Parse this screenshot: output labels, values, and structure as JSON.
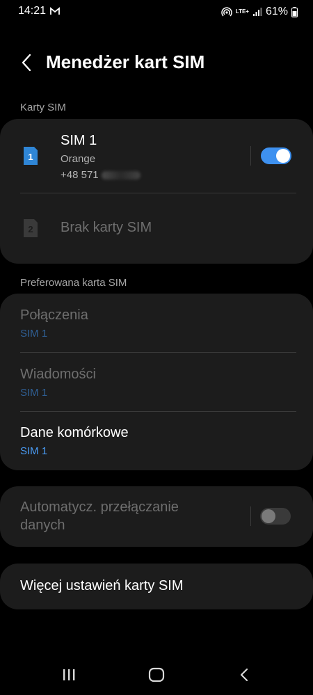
{
  "status_bar": {
    "time": "14:21",
    "battery_percent": "61%",
    "network_label": "LTE+"
  },
  "header": {
    "title": "Menedżer kart SIM"
  },
  "sim_section": {
    "label": "Karty SIM",
    "sim1": {
      "badge": "1",
      "name": "SIM 1",
      "carrier": "Orange",
      "number": "+48 571",
      "enabled": true
    },
    "sim2": {
      "badge": "2",
      "name": "Brak karty SIM"
    }
  },
  "preferred_section": {
    "label": "Preferowana karta SIM",
    "items": [
      {
        "title": "Połączenia",
        "value": "SIM 1",
        "enabled": false
      },
      {
        "title": "Wiadomości",
        "value": "SIM 1",
        "enabled": false
      },
      {
        "title": "Dane komórkowe",
        "value": "SIM 1",
        "enabled": true
      }
    ]
  },
  "auto_switch": {
    "title_line1": "Automatycz. przełączanie",
    "title_line2": "danych",
    "enabled": false
  },
  "more_settings": {
    "title": "Więcej ustawień karty SIM"
  },
  "colors": {
    "accent": "#3e91f0",
    "background": "#000000",
    "card": "#1c1c1c",
    "disabled_value": "#2f5f94",
    "enabled_value": "#4a9cf5"
  }
}
